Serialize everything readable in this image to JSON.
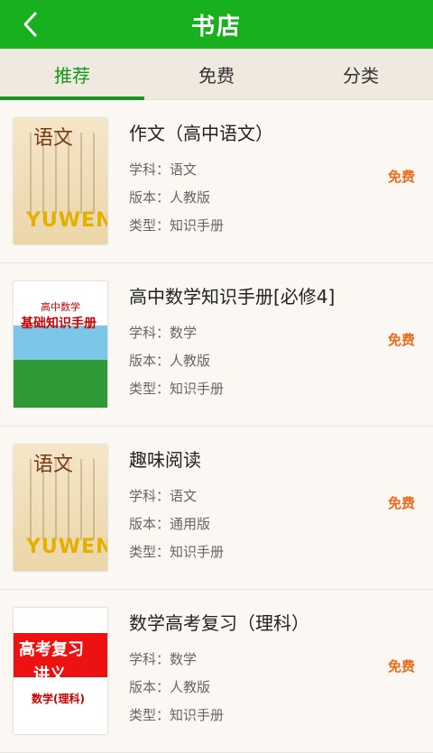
{
  "header": {
    "title": "书店"
  },
  "tabs": [
    {
      "label": "推荐"
    },
    {
      "label": "免费"
    },
    {
      "label": "分类"
    }
  ],
  "books": [
    {
      "title": "作文（高中语文）",
      "subject": "学科：语文",
      "edition": "版本：人教版",
      "type": "类型：知识手册",
      "price": "免费",
      "cover_text": [
        "语文",
        "YUWEN"
      ]
    },
    {
      "title": "高中数学知识手册[必修4]",
      "subject": "学科：数学",
      "edition": "版本：人教版",
      "type": "类型：知识手册",
      "price": "免费",
      "cover_text": [
        "高中数学",
        "基础知识手册"
      ]
    },
    {
      "title": "趣味阅读",
      "subject": "学科：语文",
      "edition": "版本：通用版",
      "type": "类型：知识手册",
      "price": "免费",
      "cover_text": [
        "语文",
        "YUWEN"
      ]
    },
    {
      "title": "数学高考复习（理科）",
      "subject": "学科：数学",
      "edition": "版本：人教版",
      "type": "类型：知识手册",
      "price": "免费",
      "cover_text": [
        "高考复习",
        "讲义",
        "数学(理科)"
      ]
    }
  ]
}
